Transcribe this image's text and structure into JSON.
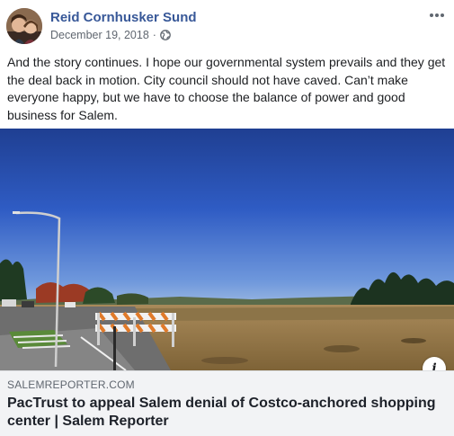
{
  "post": {
    "author": "Reid Cornhusker Sund",
    "date": "December 19, 2018",
    "separator": "·",
    "privacy_icon": "globe-icon",
    "more_icon": "more-options-icon",
    "text": "And the story continues. I hope our governmental system prevails and they get the deal back in motion. City council should not have caved. Can’t make everyone happy, but we have to choose the balance of power and good business for Salem."
  },
  "link_preview": {
    "domain": "SALEMREPORTER.COM",
    "title": "PacTrust to appeal Salem denial of Costco-anchored shopping center | Salem Reporter",
    "info_label": "i"
  },
  "colors": {
    "author": "#385898",
    "meta": "#606770",
    "text": "#1c1e21",
    "footer_bg": "#f2f3f5"
  }
}
